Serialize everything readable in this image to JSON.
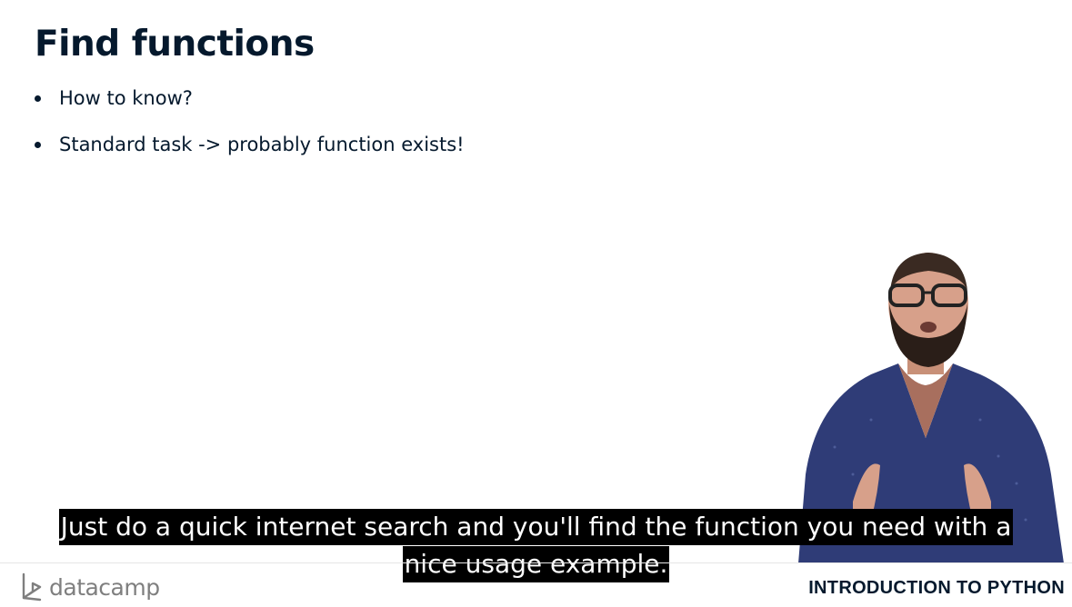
{
  "slide": {
    "title": "Find functions",
    "bullets": [
      "How to know?",
      "Standard task -> probably function exists!"
    ]
  },
  "captions": {
    "line1": "Just do a quick internet search and you'll find the function you need with a",
    "line2": "nice usage example."
  },
  "footer": {
    "logo_text": "datacamp",
    "course_title": "INTRODUCTION TO PYTHON"
  },
  "icons": {
    "logo": "datacamp-logo-icon"
  }
}
